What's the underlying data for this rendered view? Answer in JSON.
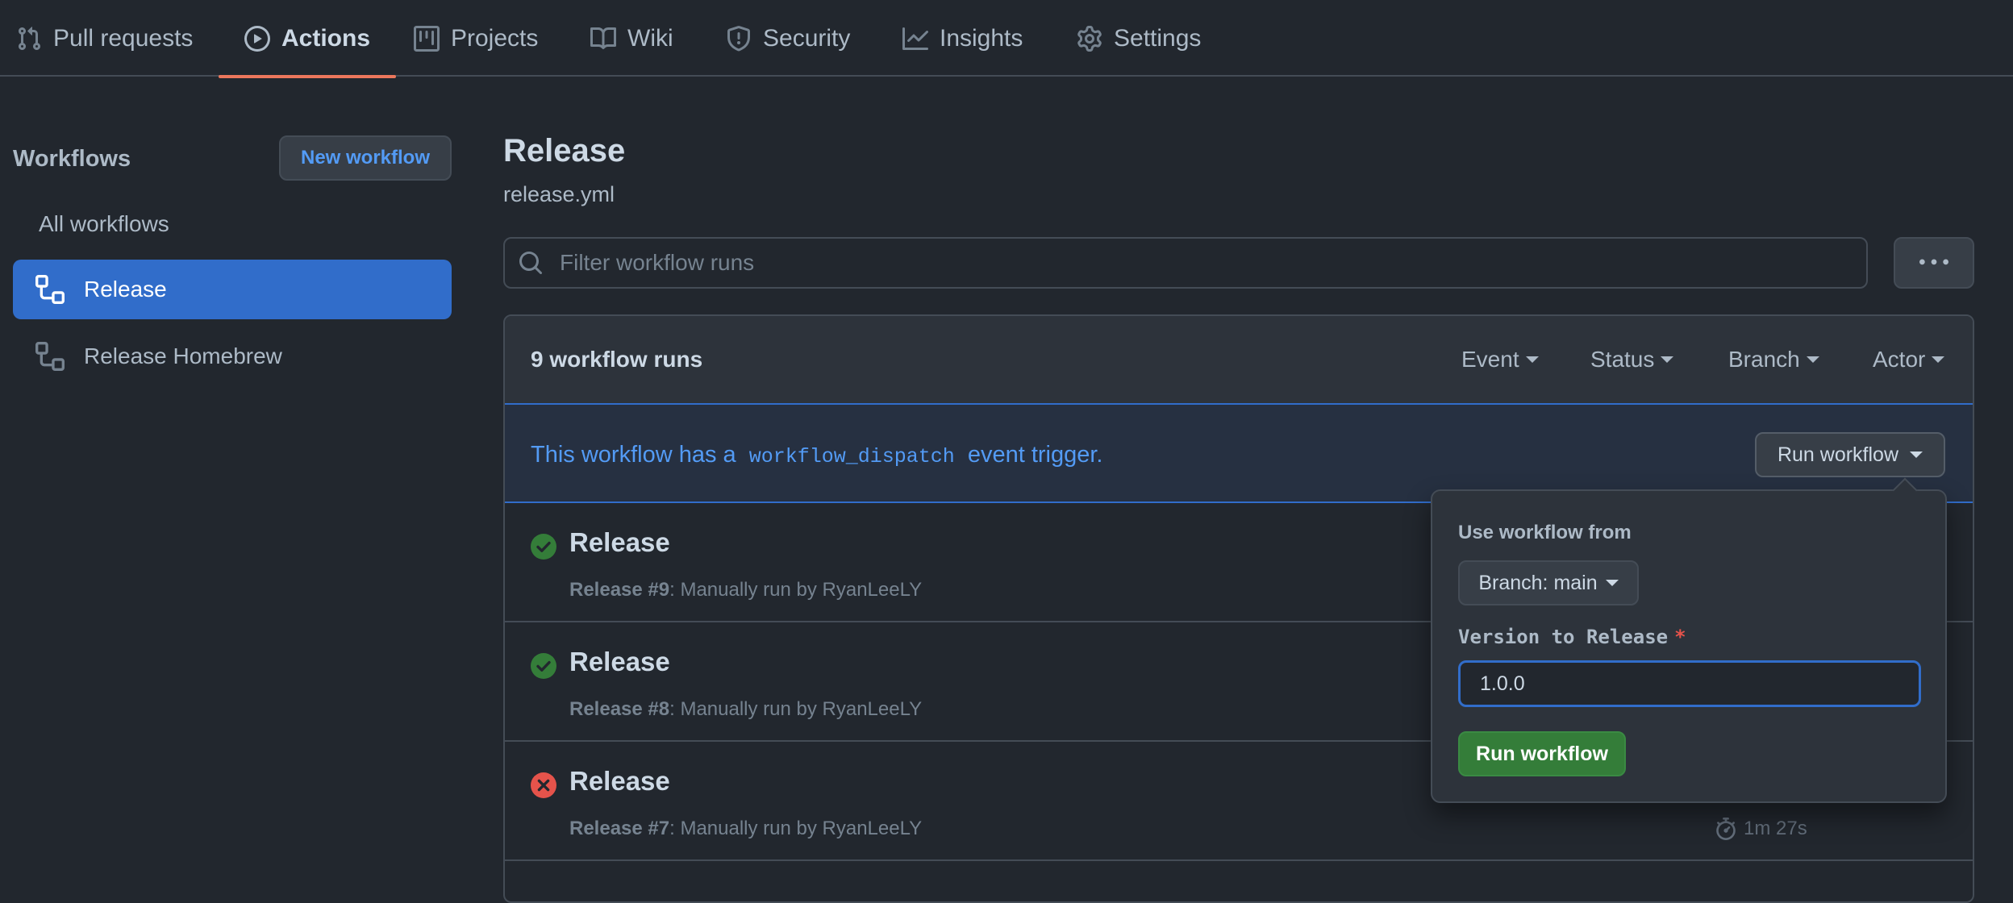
{
  "nav": {
    "tabs": [
      {
        "label": "Pull requests",
        "icon": "git-pull-request-icon"
      },
      {
        "label": "Actions",
        "icon": "play-icon",
        "active": true
      },
      {
        "label": "Projects",
        "icon": "project-board-icon"
      },
      {
        "label": "Wiki",
        "icon": "book-icon"
      },
      {
        "label": "Security",
        "icon": "shield-icon"
      },
      {
        "label": "Insights",
        "icon": "graph-icon"
      },
      {
        "label": "Settings",
        "icon": "gear-icon"
      }
    ]
  },
  "sidebar": {
    "heading": "Workflows",
    "new_button": "New workflow",
    "all_label": "All workflows",
    "items": [
      {
        "label": "Release",
        "icon": "workflow-icon",
        "selected": true
      },
      {
        "label": "Release Homebrew",
        "icon": "workflow-icon"
      }
    ]
  },
  "main": {
    "title": "Release",
    "file": "release.yml",
    "filter_placeholder": "Filter workflow runs",
    "more_icon": "kebab-horizontal-icon"
  },
  "runs": {
    "count_label": "9 workflow runs",
    "filters": [
      "Event",
      "Status",
      "Branch",
      "Actor"
    ],
    "dispatch": {
      "prefix": "This workflow has a",
      "code": "workflow_dispatch",
      "suffix": "event trigger.",
      "button": "Run workflow"
    },
    "items": [
      {
        "title": "Release",
        "run_label": "Release #9",
        "detail": ": Manually run by RyanLeeLY",
        "status": "success"
      },
      {
        "title": "Release",
        "run_label": "Release #8",
        "detail": ": Manually run by RyanLeeLY",
        "status": "success"
      },
      {
        "title": "Release",
        "run_label": "Release #7",
        "detail": ": Manually run by RyanLeeLY",
        "status": "failure",
        "duration": "1m 27s"
      }
    ]
  },
  "popover": {
    "label": "Use workflow from",
    "branch_button": "Branch: main",
    "version_label": "Version to Release",
    "required_mark": "*",
    "version_value": "1.0.0",
    "submit": "Run workflow"
  },
  "colors": {
    "background": "#22272e",
    "accent": "#539bf5",
    "selected": "#316dca",
    "success": "#347d39",
    "failure": "#e5534b",
    "active_tab_underline": "#ec775c"
  }
}
